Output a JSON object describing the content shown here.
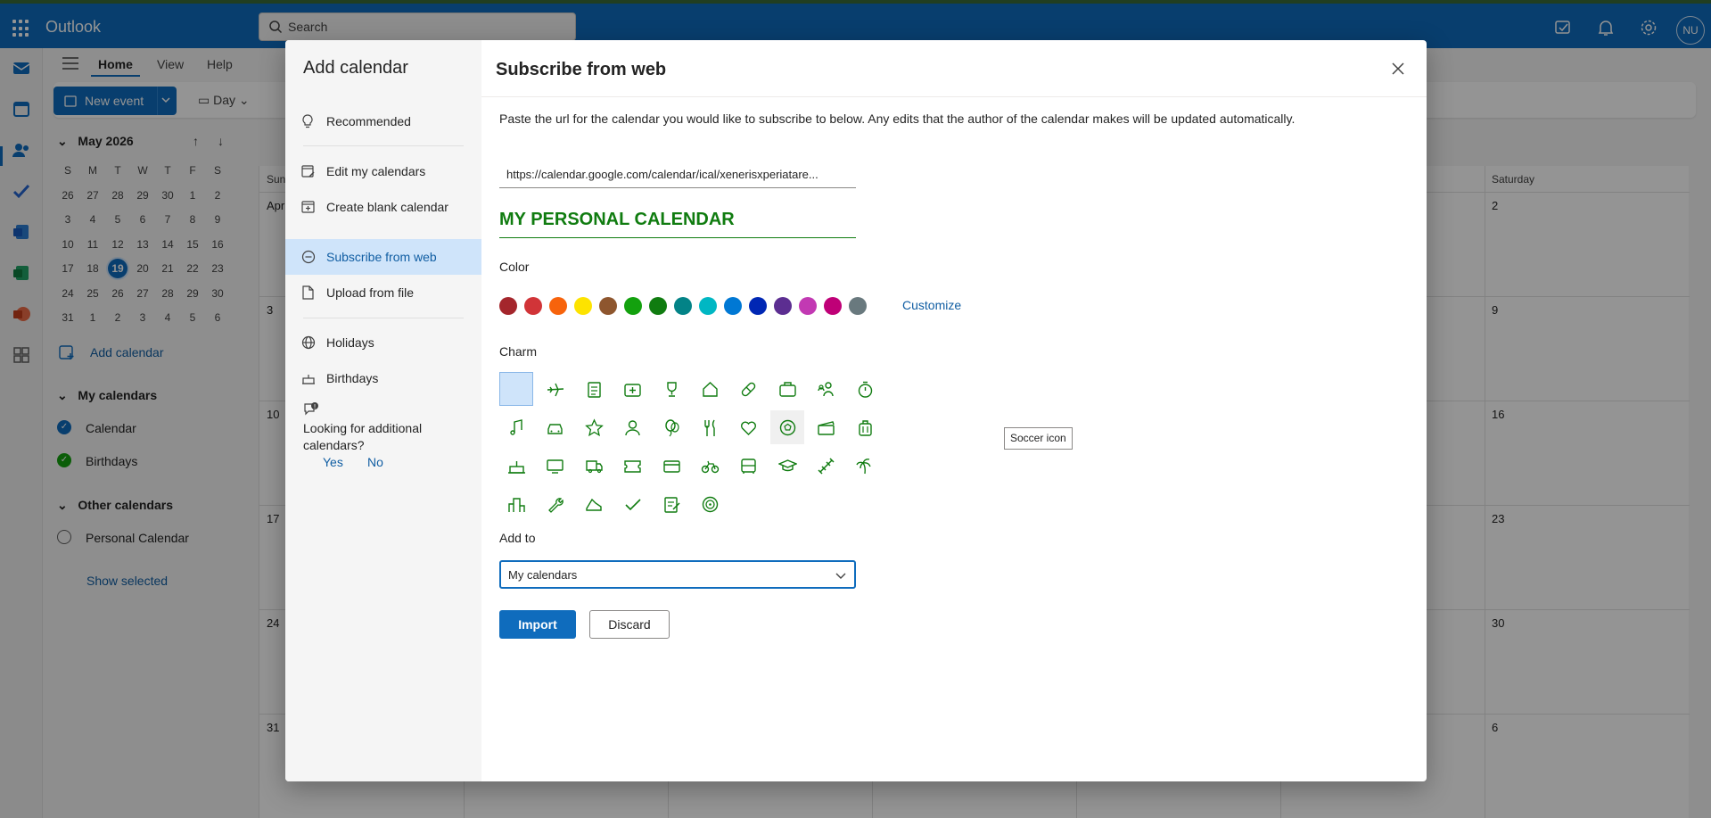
{
  "app": {
    "name": "Outlook",
    "search_placeholder": "Search",
    "avatar_initials": "NU"
  },
  "ribbon": {
    "tabs": [
      "Home",
      "View",
      "Help"
    ],
    "new_event": "New event",
    "day": "Day"
  },
  "mini_calendar": {
    "month": "May 2026",
    "dow": [
      "S",
      "M",
      "T",
      "W",
      "T",
      "F",
      "S"
    ],
    "weeks": [
      [
        "26",
        "27",
        "28",
        "29",
        "30",
        "1",
        "2"
      ],
      [
        "3",
        "4",
        "5",
        "6",
        "7",
        "8",
        "9"
      ],
      [
        "10",
        "11",
        "12",
        "13",
        "14",
        "15",
        "16"
      ],
      [
        "17",
        "18",
        "19",
        "20",
        "21",
        "22",
        "23"
      ],
      [
        "24",
        "25",
        "26",
        "27",
        "28",
        "29",
        "30"
      ],
      [
        "31",
        "1",
        "2",
        "3",
        "4",
        "5",
        "6"
      ]
    ],
    "today": "19"
  },
  "folders": {
    "add_calendar": "Add calendar",
    "my_calendars_header": "My calendars",
    "my_calendars": [
      "Calendar",
      "Birthdays"
    ],
    "other_calendars_header": "Other calendars",
    "other_calendars": [
      "Personal Calendar"
    ],
    "show_selected": "Show selected"
  },
  "background_calendar": {
    "col_sunday": "Sund",
    "col_saturday": "Saturday",
    "first_cell": "Apr",
    "sunday_nums": [
      "3",
      "10",
      "17",
      "24",
      "31"
    ],
    "saturday_nums": [
      "2",
      "9",
      "16",
      "23",
      "30",
      "6"
    ]
  },
  "dialog": {
    "sidebar_title": "Add calendar",
    "nav": {
      "recommended": "Recommended",
      "edit": "Edit my calendars",
      "create_blank": "Create blank calendar",
      "subscribe": "Subscribe from web",
      "upload": "Upload from file",
      "holidays": "Holidays",
      "birthdays": "Birthdays"
    },
    "looking_text": "Looking for additional calendars?",
    "yes": "Yes",
    "no": "No",
    "title": "Subscribe from web",
    "description": "Paste the url for the calendar you would like to subscribe to below. Any edits that the author of the calendar makes will be updated automatically.",
    "url_value": "https://calendar.google.com/calendar/ical/xenerisxperiatare...",
    "calendar_name": "MY PERSONAL CALENDAR",
    "color_label": "Color",
    "colors": [
      "#a4262c",
      "#d13438",
      "#f7630c",
      "#fde300",
      "#8e562e",
      "#13a10e",
      "#107c10",
      "#038387",
      "#00b7c3",
      "#0078d4",
      "#0027b4",
      "#5c2e91",
      "#c239b3",
      "#bf0077",
      "#69797e"
    ],
    "customize": "Customize",
    "charm_label": "Charm",
    "charms": [
      "none",
      "airplane",
      "notepad",
      "first-aid",
      "trophy",
      "home",
      "pill",
      "briefcase",
      "people",
      "stopwatch",
      "music-note",
      "car",
      "star",
      "person",
      "balloon",
      "fork-knife",
      "heart",
      "soccer",
      "movie-clapper",
      "suitcase",
      "cake",
      "monitor",
      "truck",
      "ticket",
      "credit-card",
      "bicycle",
      "bus",
      "graduation-cap",
      "dumbbell",
      "palm-tree",
      "city",
      "wrench",
      "sneaker",
      "checkmark",
      "clipboard",
      "target"
    ],
    "tooltip": "Soccer icon",
    "add_to_label": "Add to",
    "add_to_value": "My calendars",
    "import": "Import",
    "discard": "Discard"
  }
}
